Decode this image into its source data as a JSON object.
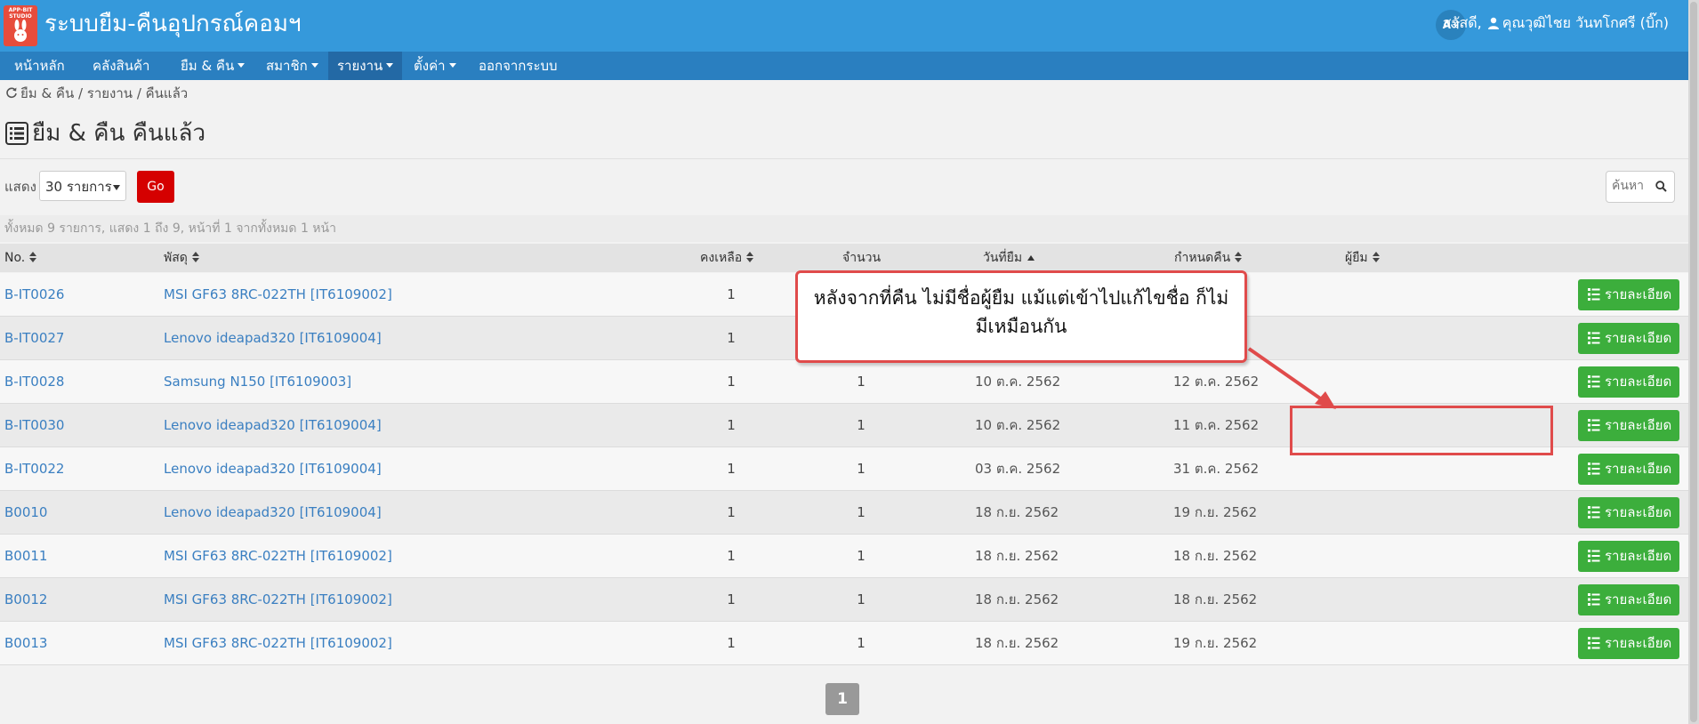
{
  "header": {
    "logo_text": "APP-BIT STUDIO",
    "title": "ระบบยืม-คืนอุปกรณ์คอมฯ",
    "lang_icon_label": "Aअ",
    "greeting": "สวัสดี,",
    "user_name": "คุณวุฒิไชย วันทโกศรี (บิ๊ก)"
  },
  "nav": {
    "items": [
      {
        "label": "หน้าหลัก",
        "dropdown": false
      },
      {
        "label": "คลังสินค้า",
        "dropdown": false
      },
      {
        "label": "ยืม & คืน",
        "dropdown": true
      },
      {
        "label": "สมาชิก",
        "dropdown": true
      },
      {
        "label": "รายงาน",
        "dropdown": true,
        "active": true
      },
      {
        "label": "ตั้งค่า",
        "dropdown": true
      },
      {
        "label": "ออกจากระบบ",
        "dropdown": false
      }
    ]
  },
  "breadcrumb": "ยืม & คืน / รายงาน / คืนแล้ว",
  "page_title": "ยืม & คืน คืนแล้ว",
  "controls": {
    "show_label": "แสดง",
    "page_size_value": "30 รายการ",
    "go_label": "Go",
    "search_placeholder": "ค้นหา"
  },
  "summary": "ทั้งหมด 9 รายการ, แสดง 1 ถึง 9, หน้าที่ 1 จากทั้งหมด 1 หน้า",
  "columns": {
    "no": "No.",
    "item": "พัสดุ",
    "remaining": "คงเหลือ",
    "quantity": "จำนวน",
    "borrow_date": "วันที่ยืม",
    "due_date": "กำหนดคืน",
    "borrower": "ผู้ยืม"
  },
  "rows": [
    {
      "no": "B-IT0026",
      "item": "MSI GF63 8RC-022TH [IT6109002]",
      "remaining": "1",
      "quantity": "",
      "borrow_date": "",
      "due_date": "",
      "borrower": ""
    },
    {
      "no": "B-IT0027",
      "item": "Lenovo ideapad320 [IT6109004]",
      "remaining": "1",
      "quantity": "",
      "borrow_date": "",
      "due_date": "",
      "borrower": ""
    },
    {
      "no": "B-IT0028",
      "item": "Samsung N150 [IT6109003]",
      "remaining": "1",
      "quantity": "1",
      "borrow_date": "10 ต.ค. 2562",
      "due_date": "12 ต.ค. 2562",
      "borrower": ""
    },
    {
      "no": "B-IT0030",
      "item": "Lenovo ideapad320 [IT6109004]",
      "remaining": "1",
      "quantity": "1",
      "borrow_date": "10 ต.ค. 2562",
      "due_date": "11 ต.ค. 2562",
      "borrower": ""
    },
    {
      "no": "B-IT0022",
      "item": "Lenovo ideapad320 [IT6109004]",
      "remaining": "1",
      "quantity": "1",
      "borrow_date": "03 ต.ค. 2562",
      "due_date": "31 ต.ค. 2562",
      "borrower": ""
    },
    {
      "no": "B0010",
      "item": "Lenovo ideapad320 [IT6109004]",
      "remaining": "1",
      "quantity": "1",
      "borrow_date": "18 ก.ย. 2562",
      "due_date": "19 ก.ย. 2562",
      "borrower": ""
    },
    {
      "no": "B0011",
      "item": "MSI GF63 8RC-022TH [IT6109002]",
      "remaining": "1",
      "quantity": "1",
      "borrow_date": "18 ก.ย. 2562",
      "due_date": "18 ก.ย. 2562",
      "borrower": ""
    },
    {
      "no": "B0012",
      "item": "MSI GF63 8RC-022TH [IT6109002]",
      "remaining": "1",
      "quantity": "1",
      "borrow_date": "18 ก.ย. 2562",
      "due_date": "18 ก.ย. 2562",
      "borrower": ""
    },
    {
      "no": "B0013",
      "item": "MSI GF63 8RC-022TH [IT6109002]",
      "remaining": "1",
      "quantity": "1",
      "borrow_date": "18 ก.ย. 2562",
      "due_date": "19 ก.ย. 2562",
      "borrower": ""
    }
  ],
  "detail_label": "รายละเอียด",
  "pagination": {
    "current": "1"
  },
  "annotation": {
    "line1": "หลังจากที่คืน ไม่มีชื่อผู้ยืม แม้แต่เข้าไปแก้ไขชื่อ ก็ไม่",
    "line2": "มีเหมือนกัน"
  },
  "colors": {
    "header": "#3599db",
    "nav": "#2a7fc0",
    "go_button": "#d50000",
    "detail_button": "#3cae3c",
    "annotation_red": "#e04b4b",
    "link": "#3a7fc1"
  }
}
